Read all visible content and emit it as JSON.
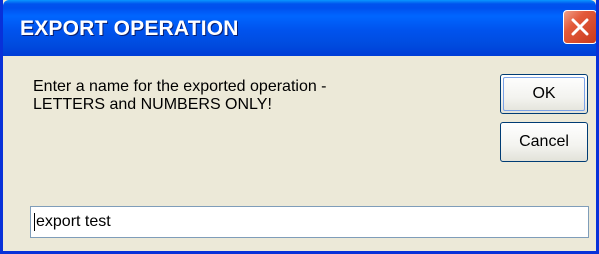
{
  "window": {
    "title": "EXPORT OPERATION"
  },
  "dialog": {
    "message_line1": "Enter a name for the exported operation -",
    "message_line2": "LETTERS and NUMBERS ONLY!",
    "ok_label": "OK",
    "cancel_label": "Cancel",
    "name_value": "export test"
  },
  "icons": {
    "close": "close-icon"
  },
  "colors": {
    "titlebar": "#0053ee",
    "title_text": "#ffffff",
    "close_button": "#e35a3a",
    "dialog_background": "#ece9d8",
    "button_border": "#003c74",
    "input_border": "#7f9db9"
  }
}
